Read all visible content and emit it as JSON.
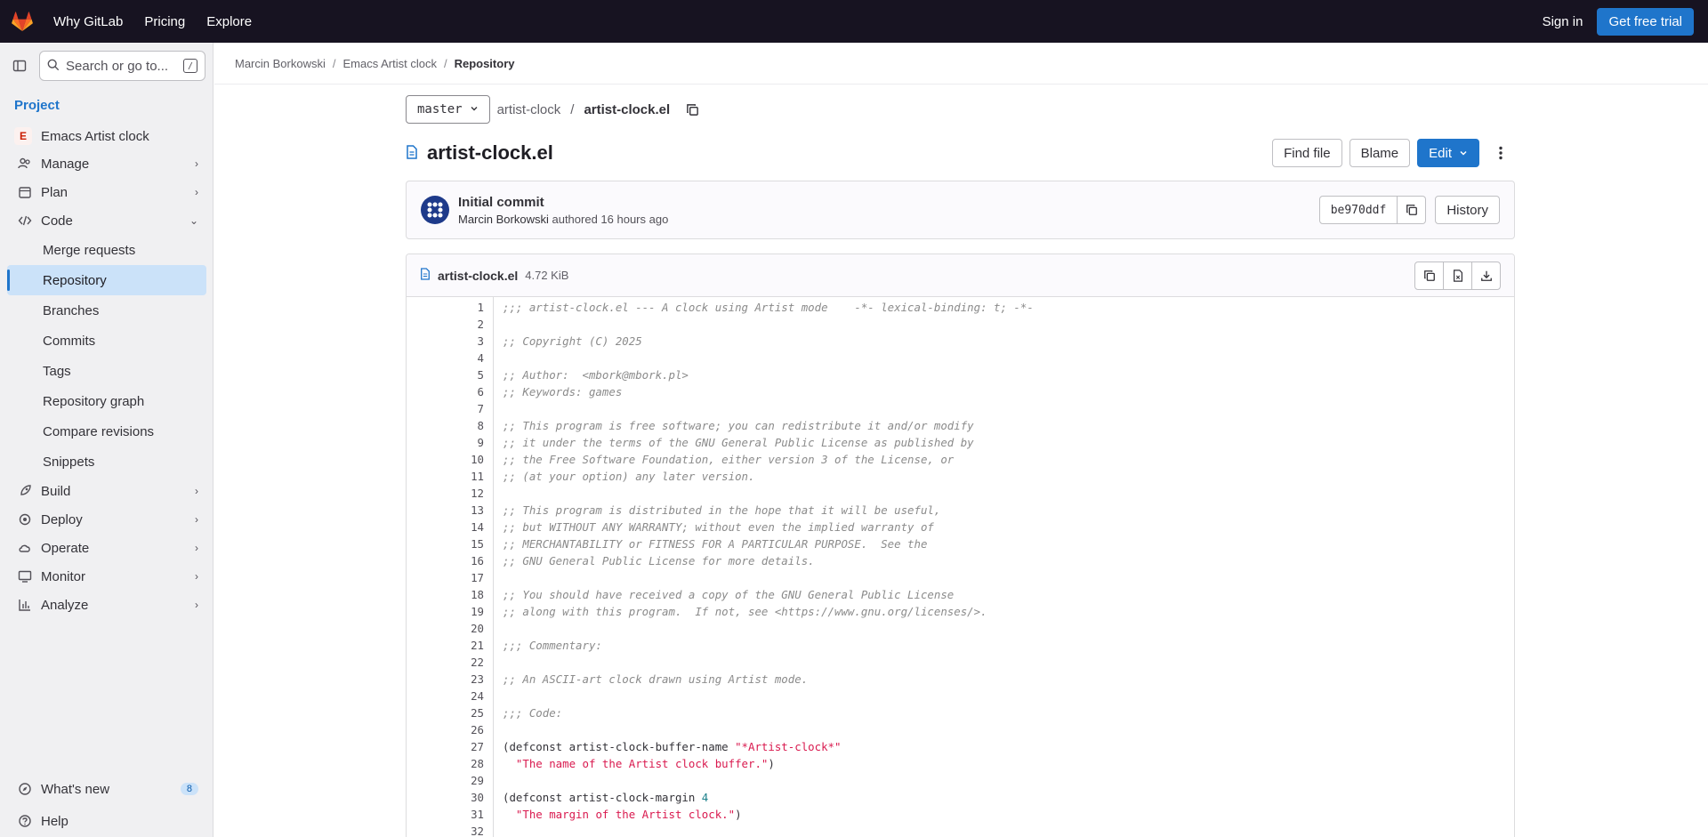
{
  "topbar": {
    "nav": [
      "Why GitLab",
      "Pricing",
      "Explore"
    ],
    "sign_in": "Sign in",
    "trial": "Get free trial"
  },
  "sidebar": {
    "search_placeholder": "Search or go to...",
    "search_shortcut": "/",
    "heading": "Project",
    "project_initial": "E",
    "project_name": "Emacs Artist clock",
    "sections": {
      "manage": "Manage",
      "plan": "Plan",
      "code": "Code",
      "build": "Build",
      "deploy": "Deploy",
      "operate": "Operate",
      "monitor": "Monitor",
      "analyze": "Analyze"
    },
    "code_items": [
      "Merge requests",
      "Repository",
      "Branches",
      "Commits",
      "Tags",
      "Repository graph",
      "Compare revisions",
      "Snippets"
    ],
    "whats_new": "What's new",
    "whats_new_count": "8",
    "help": "Help"
  },
  "breadcrumb": [
    "Marcin Borkowski",
    "Emacs Artist clock",
    "Repository"
  ],
  "path": {
    "branch": "master",
    "dir": "artist-clock",
    "file": "artist-clock.el"
  },
  "title": "artist-clock.el",
  "actions": {
    "find_file": "Find file",
    "blame": "Blame",
    "edit": "Edit"
  },
  "commit": {
    "title": "Initial commit",
    "author": "Marcin Borkowski",
    "meta": "authored 16 hours ago",
    "sha": "be970ddf",
    "history": "History"
  },
  "file": {
    "name": "artist-clock.el",
    "size": "4.72 KiB"
  },
  "code_lines": [
    ";;; artist-clock.el --- A clock using Artist mode    -*- lexical-binding: t; -*-",
    "",
    ";; Copyright (C) 2025",
    "",
    ";; Author:  <mbork@mbork.pl>",
    ";; Keywords: games",
    "",
    ";; This program is free software; you can redistribute it and/or modify",
    ";; it under the terms of the GNU General Public License as published by",
    ";; the Free Software Foundation, either version 3 of the License, or",
    ";; (at your option) any later version.",
    "",
    ";; This program is distributed in the hope that it will be useful,",
    ";; but WITHOUT ANY WARRANTY; without even the implied warranty of",
    ";; MERCHANTABILITY or FITNESS FOR A PARTICULAR PURPOSE.  See the",
    ";; GNU General Public License for more details.",
    "",
    ";; You should have received a copy of the GNU General Public License",
    ";; along with this program.  If not, see <https://www.gnu.org/licenses/>.",
    "",
    ";;; Commentary:",
    "",
    ";; An ASCII-art clock drawn using Artist mode.",
    "",
    ";;; Code:",
    "",
    "(defconst artist-clock-buffer-name \"*Artist-clock*\"",
    "  \"The name of the Artist clock buffer.\")",
    "",
    "(defconst artist-clock-margin 4",
    "  \"The margin of the Artist clock.\")",
    ""
  ],
  "colors": {
    "topbar": "#171321",
    "accent": "#1f75cb",
    "sidebar": "#f0f0f2",
    "active_item": "#cbe2f9",
    "string": "#d91a4f",
    "comment": "#8b8b8b"
  }
}
